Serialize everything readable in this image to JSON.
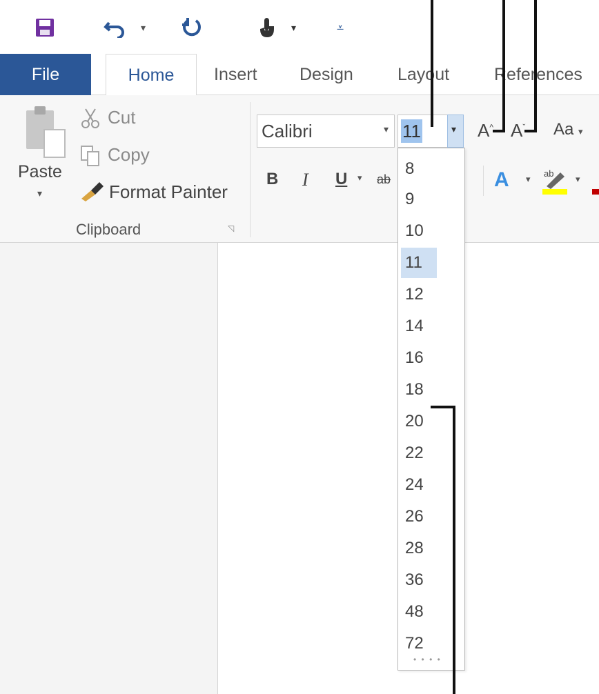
{
  "tabs": [
    {
      "label": "File"
    },
    {
      "label": "Home"
    },
    {
      "label": "Insert"
    },
    {
      "label": "Design"
    },
    {
      "label": "Layout"
    },
    {
      "label": "References"
    }
  ],
  "clipboard": {
    "paste": "Paste",
    "cut": "Cut",
    "copy": "Copy",
    "format_painter": "Format Painter",
    "group_label": "Clipboard"
  },
  "font": {
    "name": "Calibri",
    "size": "11",
    "grow_label": "A",
    "shrink_label": "A",
    "case_label": "Aa",
    "bold": "B",
    "italic": "I",
    "underline": "U",
    "strike": "ab"
  },
  "size_list": [
    "8",
    "9",
    "10",
    "11",
    "12",
    "14",
    "16",
    "18",
    "20",
    "22",
    "24",
    "26",
    "28",
    "36",
    "48",
    "72"
  ],
  "selected_size": "11",
  "colors": {
    "accent": "#2b5797",
    "selection": "#cfe0f3",
    "highlight": "#ffff00",
    "font_color": "#c00000"
  }
}
